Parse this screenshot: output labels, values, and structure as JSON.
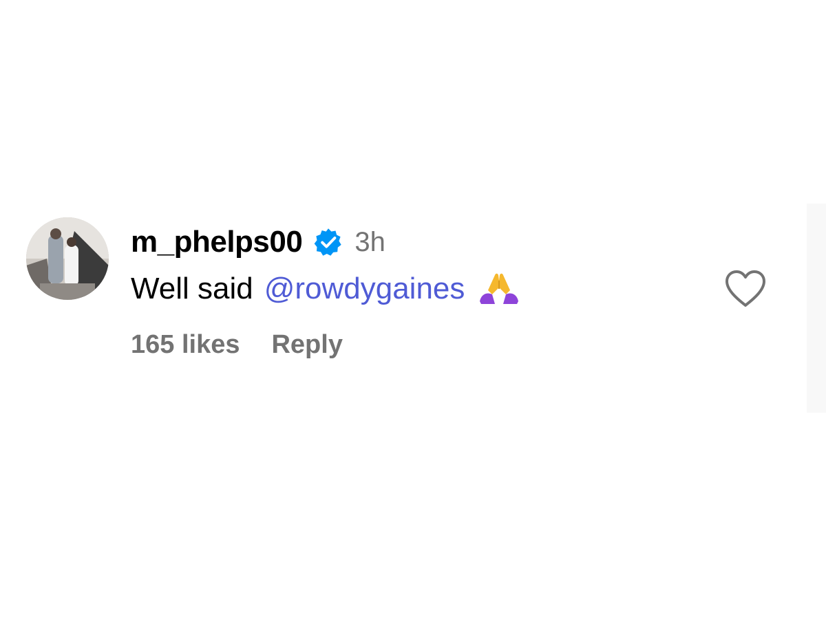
{
  "comment": {
    "username": "m_phelps00",
    "verified_icon": "verified-badge-icon",
    "time_ago": "3h",
    "text_prefix": "Well said",
    "mention": "@rowdygaines",
    "emoji": "🙏",
    "likes": "165 likes",
    "reply_label": "Reply",
    "like_icon": "heart-outline-icon"
  },
  "colors": {
    "username": "#000000",
    "meta": "#737373",
    "mention": "#4f5bd5",
    "verified": "#0095f6"
  }
}
